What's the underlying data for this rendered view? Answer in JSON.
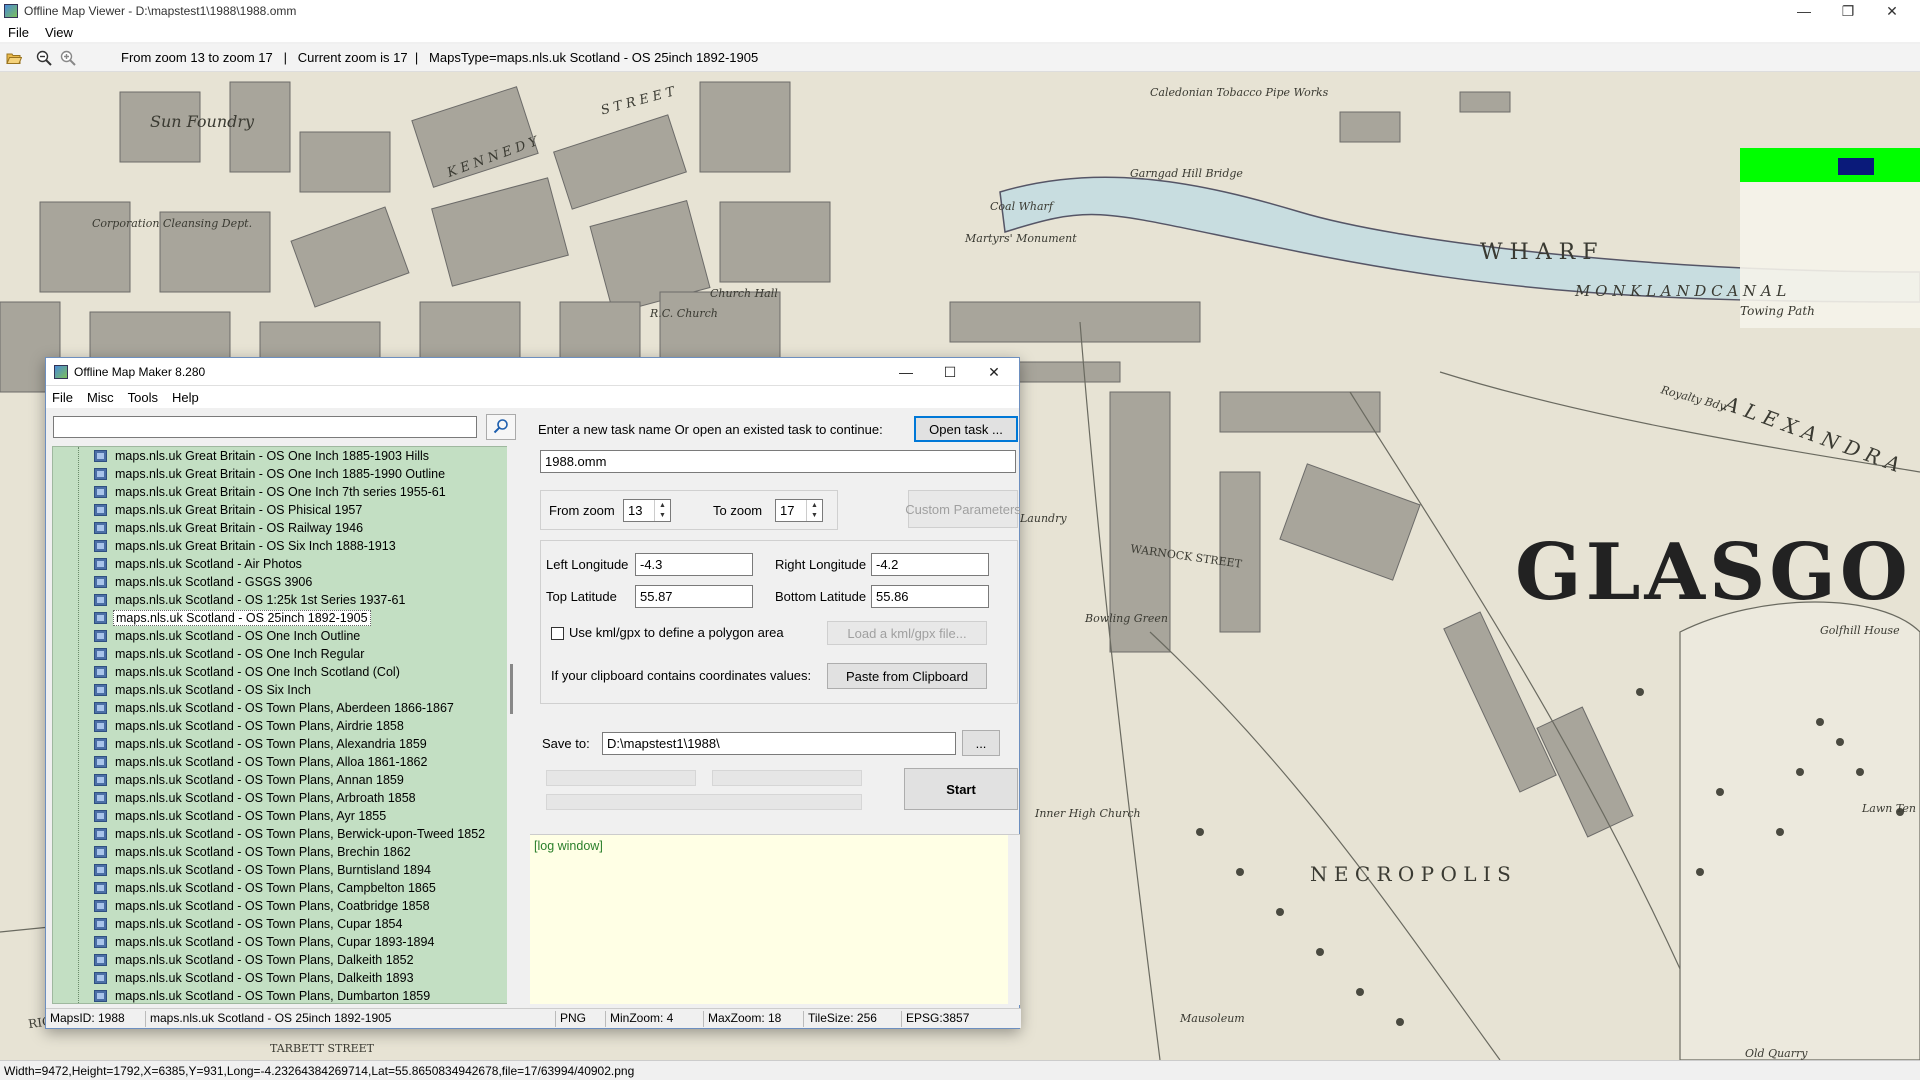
{
  "outer_window": {
    "title": "Offline Map Viewer - D:\\mapstest1\\1988\\1988.omm",
    "menu": [
      "File",
      "View"
    ],
    "toolbar_info": "From zoom 13 to zoom 17   |   Current zoom is 17  |   MapsType=maps.nls.uk Scotland - OS 25inch 1892-1905",
    "status": "Width=9472,Height=1792,X=6385,Y=931,Long=-4.23264384269714,Lat=55.8650834942678,file=17/63994/40902.png"
  },
  "map_labels": {
    "glasgow": "GLASGO",
    "wharf": "W H A R F",
    "monkland_canal": "M O N K L A N D   C A N A L",
    "alexandra": "A L E X A N D R A",
    "necropolis": "N E C R O P O L I S",
    "sun_foundry": "Sun Foundry",
    "caledonian": "Caledonian Tobacco Pipe Works",
    "kennedy": "K E N N E D Y",
    "street": "S T R E E T",
    "warnock": "WARNOCK STREET",
    "golfhill": "Golfhill House",
    "inner_high": "Inner High Church",
    "bowling": "Bowling Green",
    "laundry": "Laundry",
    "towing_path": "Towing Path",
    "royalty": "Royalty Bdy.",
    "lawn_tennis": "Lawn Ten Ground",
    "old_quarry": "Old Quarry",
    "richmond": "RICHMOND",
    "tarbett": "TARBETT STREET",
    "corporation": "Corporation Cleansing Dept.",
    "coal_wharf": "Coal Wharf",
    "martyrs": "Martyrs' Monument",
    "church_hall": "Church Hall",
    "rc_church": "R.C. Church",
    "mausoleum": "Mausoleum",
    "garngad": "Garngad Hill Bridge"
  },
  "dialog": {
    "title": "Offline Map Maker 8.280",
    "menu": [
      "File",
      "Misc",
      "Tools",
      "Help"
    ],
    "search_value": "",
    "tree_items": [
      "maps.nls.uk Great Britain - OS One Inch 1885-1903 Hills",
      "maps.nls.uk Great Britain - OS One Inch 1885-1990 Outline",
      "maps.nls.uk Great Britain - OS One Inch 7th series 1955-61",
      "maps.nls.uk Great Britain - OS Phisical 1957",
      "maps.nls.uk Great Britain - OS Railway 1946",
      "maps.nls.uk Great Britain - OS Six Inch 1888-1913",
      "maps.nls.uk Scotland - Air Photos",
      "maps.nls.uk Scotland - GSGS 3906",
      "maps.nls.uk Scotland - OS 1:25k 1st Series 1937-61",
      "maps.nls.uk Scotland - OS 25inch 1892-1905",
      "maps.nls.uk Scotland - OS One Inch Outline",
      "maps.nls.uk Scotland - OS One Inch Regular",
      "maps.nls.uk Scotland - OS One Inch Scotland (Col)",
      "maps.nls.uk Scotland - OS Six Inch",
      "maps.nls.uk Scotland - OS Town Plans, Aberdeen 1866-1867",
      "maps.nls.uk Scotland - OS Town Plans, Airdrie 1858",
      "maps.nls.uk Scotland - OS Town Plans, Alexandria 1859",
      "maps.nls.uk Scotland - OS Town Plans, Alloa 1861-1862",
      "maps.nls.uk Scotland - OS Town Plans, Annan 1859",
      "maps.nls.uk Scotland - OS Town Plans, Arbroath 1858",
      "maps.nls.uk Scotland - OS Town Plans, Ayr 1855",
      "maps.nls.uk Scotland - OS Town Plans, Berwick-upon-Tweed 1852",
      "maps.nls.uk Scotland - OS Town Plans, Brechin 1862",
      "maps.nls.uk Scotland - OS Town Plans, Burntisland 1894",
      "maps.nls.uk Scotland - OS Town Plans, Campbelton 1865",
      "maps.nls.uk Scotland - OS Town Plans, Coatbridge 1858",
      "maps.nls.uk Scotland - OS Town Plans, Cupar 1854",
      "maps.nls.uk Scotland - OS Town Plans, Cupar 1893-1894",
      "maps.nls.uk Scotland - OS Town Plans, Dalkeith 1852",
      "maps.nls.uk Scotland - OS Town Plans, Dalkeith 1893",
      "maps.nls.uk Scotland - OS Town Plans, Dumbarton 1859"
    ],
    "selected_item": "maps.nls.uk Scotland - OS 25inch 1892-1905",
    "task_prompt": "Enter a new task name Or open an existed task to continue:",
    "open_task_label": "Open task ...",
    "task_name": "1988.omm",
    "from_zoom_label": "From zoom",
    "from_zoom": "13",
    "to_zoom_label": "To zoom",
    "to_zoom": "17",
    "custom_params_label": "Custom Parameters",
    "left_lon_label": "Left Longitude",
    "left_lon": "-4.3",
    "right_lon_label": "Right Longitude",
    "right_lon": "-4.2",
    "top_lat_label": "Top Latitude",
    "top_lat": "55.87",
    "bottom_lat_label": "Bottom Latitude",
    "bottom_lat": "55.86",
    "kml_checkbox_label": "Use kml/gpx to define a polygon area",
    "kml_checked": false,
    "load_kml_label": "Load a kml/gpx file...",
    "clipboard_prompt": "If your clipboard contains coordinates values:",
    "paste_label": "Paste from Clipboard",
    "save_to_label": "Save to:",
    "save_to": "D:\\mapstest1\\1988\\",
    "browse_label": "...",
    "start_label": "Start",
    "log_text": "[log window]",
    "status": {
      "maps_id": "MapsID: 1988",
      "maps_name": "maps.nls.uk Scotland - OS 25inch 1892-1905",
      "format": "PNG",
      "min_zoom": "MinZoom: 4",
      "max_zoom": "MaxZoom: 18",
      "tile_size": "TileSize: 256",
      "epsg": "EPSG:3857"
    }
  },
  "colors": {
    "tree_bg": "#c3dfc3",
    "log_bg": "#ffffe5",
    "minimap_green": "#00ff00",
    "minimap_blue": "#0a1a7a",
    "canal": "#c8dde0"
  },
  "icons": [
    "folder-open-icon",
    "zoom-out-icon",
    "zoom-in-icon",
    "search-icon",
    "minimize-icon",
    "maximize-icon",
    "close-icon",
    "restore-icon"
  ]
}
